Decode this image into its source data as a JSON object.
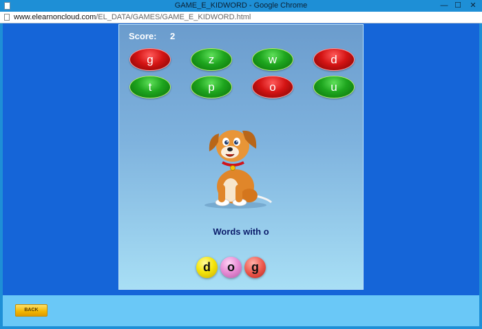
{
  "window": {
    "title": "GAME_E_KIDWORD - Google Chrome",
    "minimize_glyph": "—",
    "maximize_glyph": "☐",
    "close_glyph": "✕"
  },
  "urlbar": {
    "domain": "www.elearnoncloud.com",
    "path": "/EL_DATA/GAMES/GAME_E_KIDWORD.html"
  },
  "game": {
    "score_label": "Score:",
    "score_value": "2",
    "letters": [
      {
        "letter": "g",
        "color": "red"
      },
      {
        "letter": "z",
        "color": "green"
      },
      {
        "letter": "w",
        "color": "green"
      },
      {
        "letter": "d",
        "color": "red"
      },
      {
        "letter": "t",
        "color": "green"
      },
      {
        "letter": "p",
        "color": "green"
      },
      {
        "letter": "o",
        "color": "red"
      },
      {
        "letter": "u",
        "color": "green"
      }
    ],
    "image": "dog-illustration",
    "prompt": "Words with o",
    "answer_tiles": [
      {
        "letter": "d",
        "color": "yellow"
      },
      {
        "letter": "o",
        "color": "pink"
      },
      {
        "letter": "g",
        "color": "red"
      }
    ]
  },
  "footer": {
    "back_label": "BACK"
  },
  "colors": {
    "page_bg": "#1565d8",
    "footer_bg": "#6ac8f7",
    "prompt_text": "#0c1d6b"
  }
}
